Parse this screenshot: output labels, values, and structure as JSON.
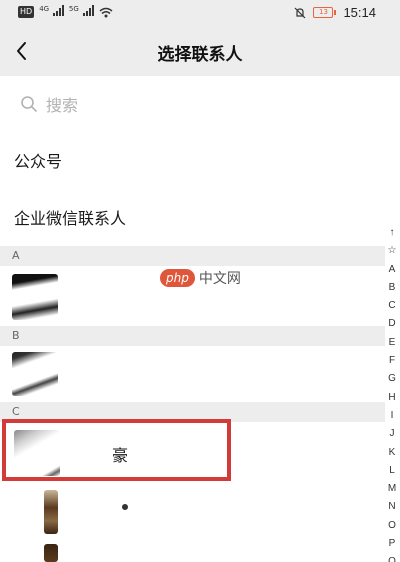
{
  "status_bar": {
    "hd_label": "HD",
    "network_1": "4G",
    "network_2": "5G",
    "battery_level": "13",
    "time": "15:14"
  },
  "nav": {
    "title": "选择联系人"
  },
  "search": {
    "placeholder": "搜索"
  },
  "list": {
    "public_accounts": "公众号",
    "work_contacts": "企业微信联系人",
    "sections": [
      {
        "letter": "A"
      },
      {
        "letter": "B"
      },
      {
        "letter": "C"
      }
    ],
    "highlighted_contact_name": "豪"
  },
  "watermark": {
    "logo": "php",
    "text": "中文网"
  },
  "index_bar": [
    "↑",
    "☆",
    "A",
    "B",
    "C",
    "D",
    "E",
    "F",
    "G",
    "H",
    "I",
    "J",
    "K",
    "L",
    "M",
    "N",
    "O",
    "P",
    "Q"
  ],
  "colors": {
    "highlight": "#d33a3a",
    "header_bg": "#ededed"
  }
}
